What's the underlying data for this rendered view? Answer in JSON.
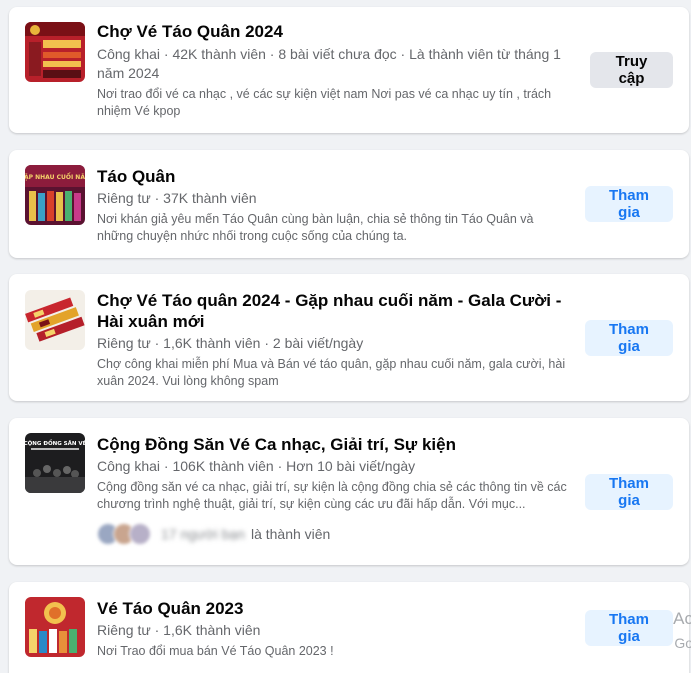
{
  "groups": [
    {
      "title": "Chợ Vé Táo Quân 2024",
      "meta": "Công khai · 42K thành viên · 8 bài viết chưa đọc · Là thành viên từ tháng 1 năm 2024",
      "description": "Nơi trao đổi vé ca nhạc , vé các sự kiện việt nam Nơi pas vé ca nhạc uy tín , trách nhiệm Vé kpop",
      "button": "Truy cập"
    },
    {
      "title": "Táo Quân",
      "meta": "Riêng tư · 37K thành viên",
      "description": "Nơi khán giả yêu mến Táo Quân cùng bàn luận, chia sẻ thông tin Táo Quân và những chuyện nhức nhối trong cuộc sống của chúng ta.",
      "button": "Tham gia"
    },
    {
      "title": "Chợ Vé Táo quân 2024 - Gặp nhau cuối năm - Gala Cười - Hài xuân mới",
      "meta": "Riêng tư · 1,6K thành viên · 2 bài viết/ngày",
      "description": "Chợ công khai miễn phí Mua và Bán vé táo quân, gặp nhau cuối năm, gala cười, hài xuân 2024. Vui lòng không spam",
      "button": "Tham gia"
    },
    {
      "title": "Cộng Đồng Săn Vé Ca nhạc, Giải trí, Sự kiện",
      "meta": "Công khai · 106K thành viên · Hơn 10 bài viết/ngày",
      "description": "Cộng đồng săn vé ca nhạc, giải trí, sự kiện là cộng đồng chia sẻ các thông tin về các chương trình nghệ thuật, giải trí, sự kiện cùng các ưu đãi hấp dẫn. Với mục...",
      "button": "Tham gia",
      "members_blurred": "17 người bạn",
      "members_suffix": "là thành viên"
    },
    {
      "title": "Vé Táo Quân 2023",
      "meta": "Riêng tư · 1,6K thành viên",
      "description": "Nơi Trao đổi mua bán Vé Táo Quân 2023 !",
      "button": "Tham gia"
    }
  ],
  "thumb_labels": {
    "g2": "GẶP NHAU CUỐI NĂM",
    "g4": "CỘNG ĐỒNG SĂN VÉ"
  },
  "side_text": [
    "Ac",
    "Go"
  ],
  "colors": {
    "page_bg": "#f0f2f5",
    "primary_blue": "#1877f2",
    "join_button_bg": "#e7f3ff",
    "access_button_bg": "#e4e6eb",
    "secondary_text": "#65676b"
  }
}
